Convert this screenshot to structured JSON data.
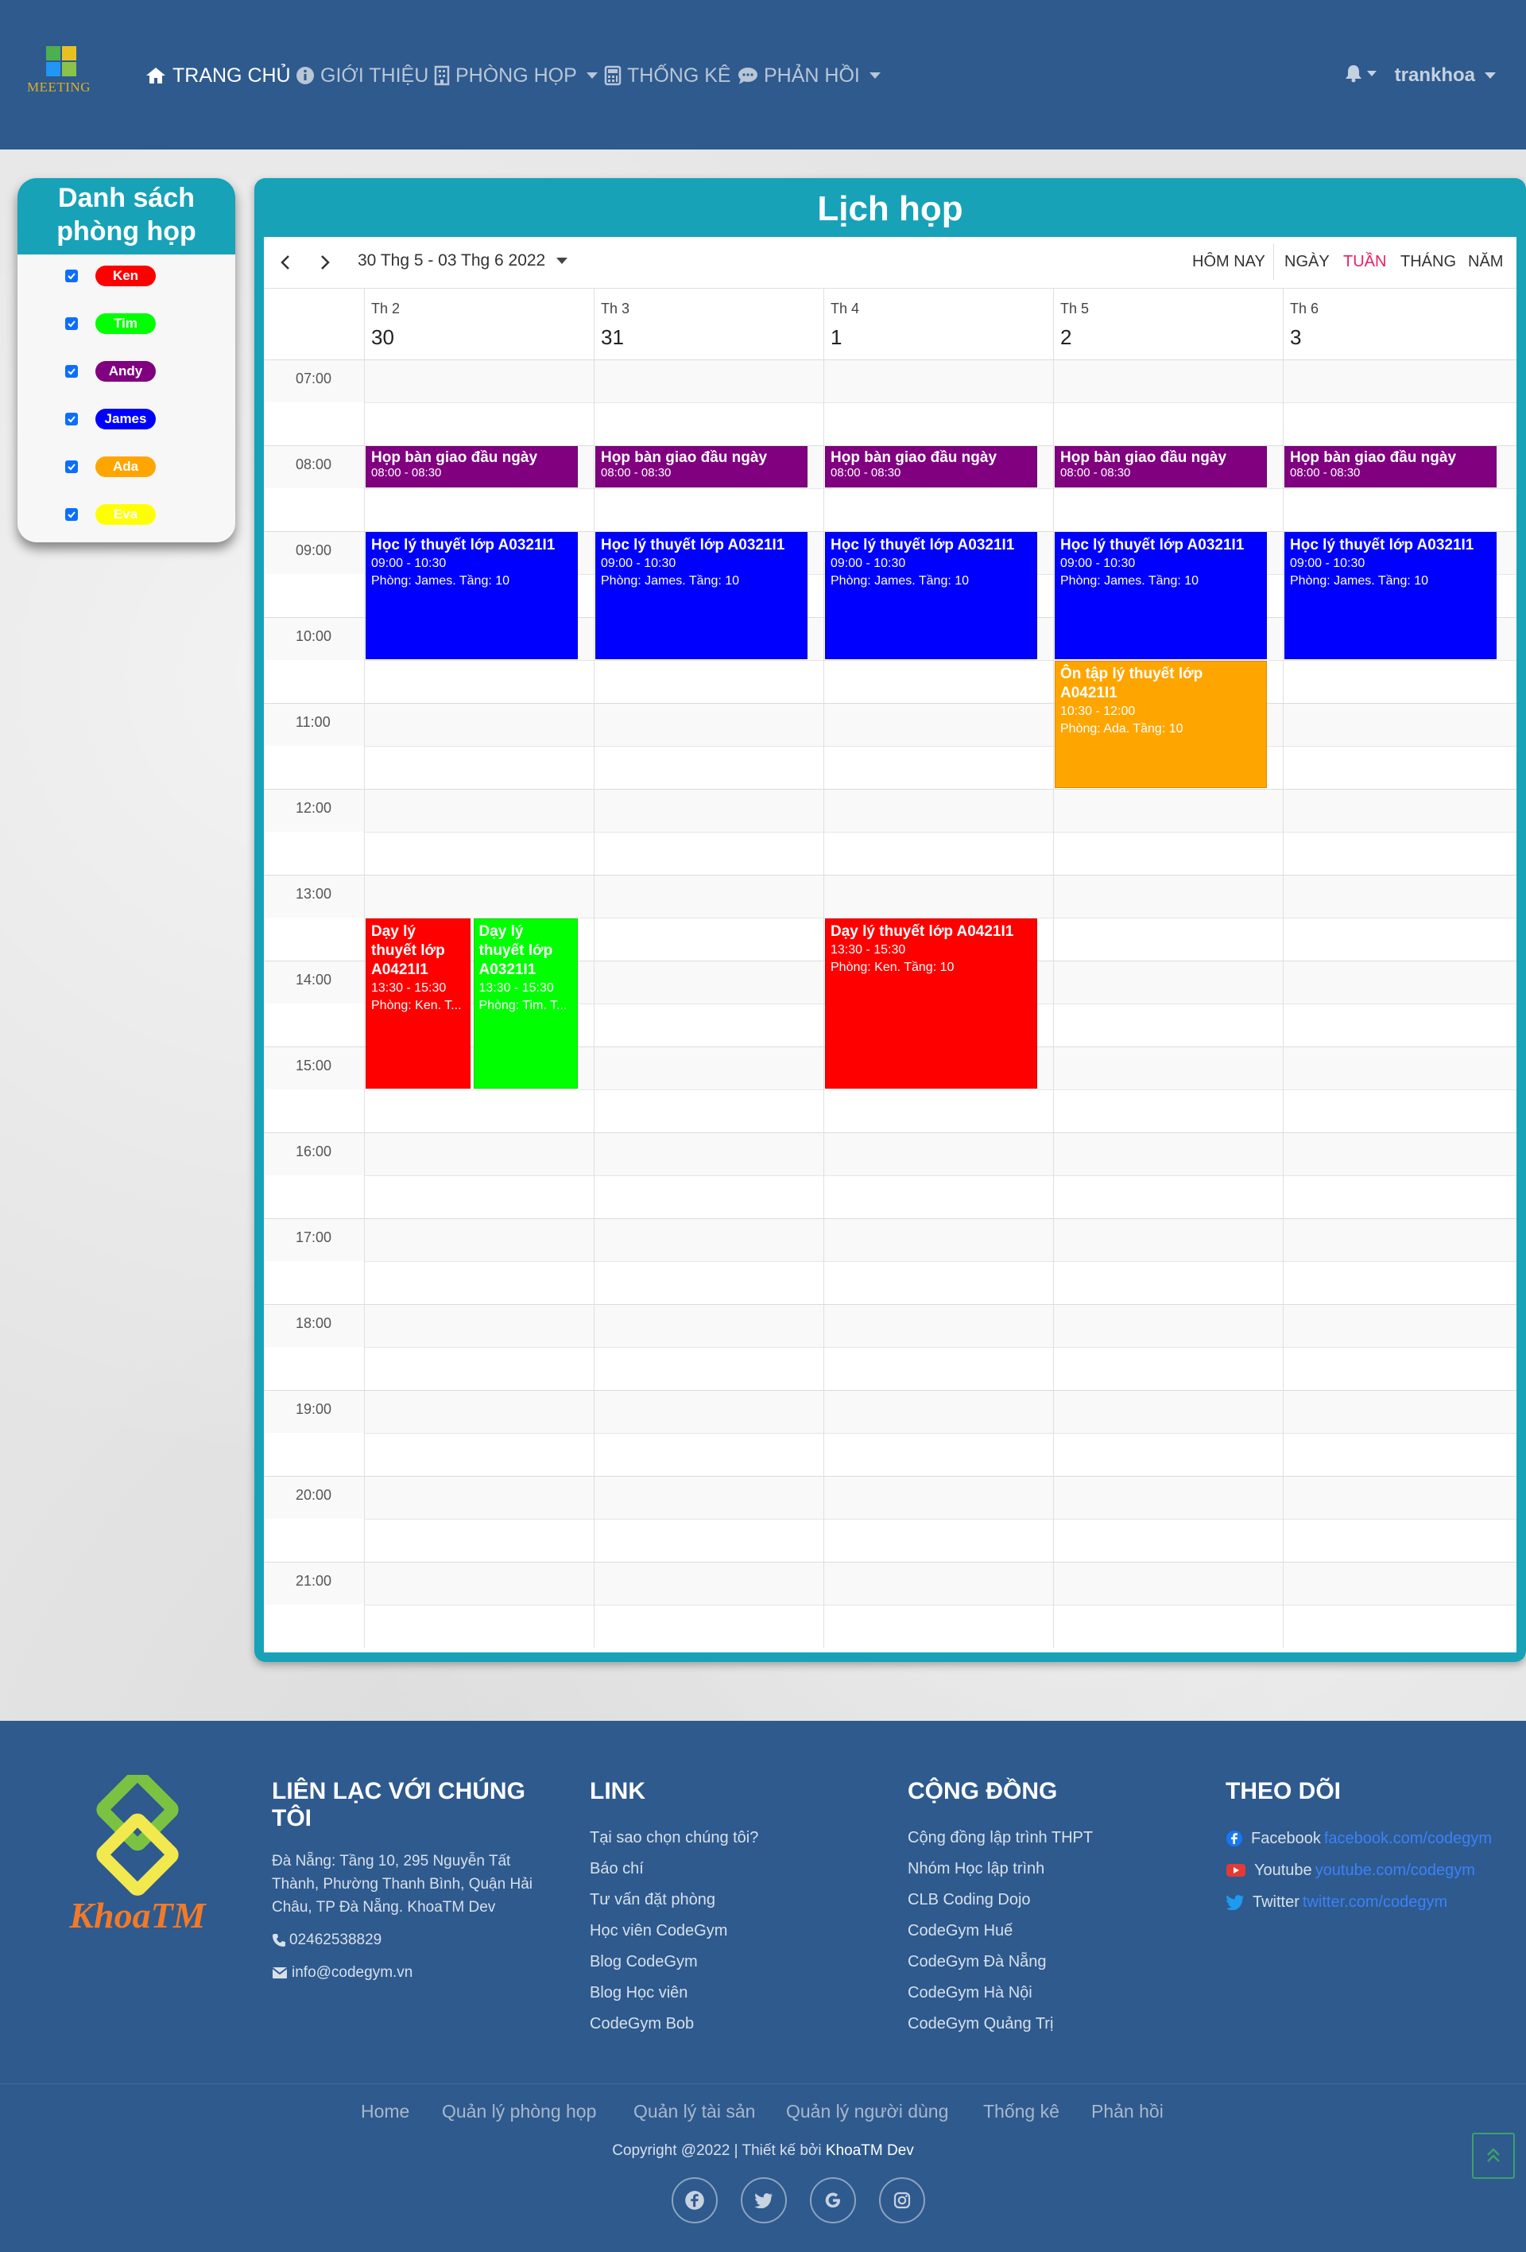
{
  "nav": {
    "logo_text": "MEETING",
    "items": [
      {
        "label": "TRANG CHỦ",
        "icon": "home-icon"
      },
      {
        "label": "GIỚI THIỆU",
        "icon": "info-icon"
      },
      {
        "label": "PHÒNG HỌP",
        "icon": "building-icon"
      },
      {
        "label": "THỐNG KÊ",
        "icon": "calculator-icon"
      },
      {
        "label": "PHẢN HỒI",
        "icon": "comment-icon"
      }
    ],
    "username": "trankhoa"
  },
  "rooms": {
    "title_line1": "Danh sách",
    "title_line2": "phòng họp",
    "items": [
      {
        "name": "Ken",
        "color": "#ff0000",
        "checked": true
      },
      {
        "name": "Tim",
        "color": "#00ff00",
        "checked": true
      },
      {
        "name": "Andy",
        "color": "#800080",
        "checked": true
      },
      {
        "name": "James",
        "color": "#0000ff",
        "checked": true
      },
      {
        "name": "Ada",
        "color": "#ffa500",
        "checked": true
      },
      {
        "name": "Eva",
        "color": "#ffff00",
        "checked": true
      }
    ]
  },
  "calendar": {
    "title": "Lịch họp",
    "range": "30 Thg 5 - 03 Thg 6 2022",
    "views": {
      "today": "HÔM NAY",
      "day": "NGÀY",
      "week": "TUẦN",
      "month": "THÁNG",
      "year": "NĂM"
    },
    "days": [
      {
        "name": "Th 2",
        "date": "30"
      },
      {
        "name": "Th 3",
        "date": "31"
      },
      {
        "name": "Th 4",
        "date": "1"
      },
      {
        "name": "Th 5",
        "date": "2"
      },
      {
        "name": "Th 6",
        "date": "3"
      }
    ],
    "hours": [
      "07:00",
      "08:00",
      "09:00",
      "10:00",
      "11:00",
      "12:00",
      "13:00",
      "14:00",
      "15:00",
      "16:00",
      "17:00",
      "18:00",
      "19:00",
      "20:00",
      "21:00"
    ],
    "events": [
      {
        "day": 0,
        "title": "Họp bàn giao đầu ngày",
        "time": "08:00 - 08:30",
        "room": "",
        "color": "purple"
      },
      {
        "day": 1,
        "title": "Họp bàn giao đầu ngày",
        "time": "08:00 - 08:30",
        "room": "",
        "color": "purple"
      },
      {
        "day": 2,
        "title": "Họp bàn giao đầu ngày",
        "time": "08:00 - 08:30",
        "room": "",
        "color": "purple"
      },
      {
        "day": 3,
        "title": "Họp bàn giao đầu ngày",
        "time": "08:00 - 08:30",
        "room": "",
        "color": "purple"
      },
      {
        "day": 4,
        "title": "Họp bàn giao đầu ngày",
        "time": "08:00 - 08:30",
        "room": "",
        "color": "purple"
      },
      {
        "day": 0,
        "title": "Học lý thuyết lớp A0321I1",
        "time": "09:00 - 10:30",
        "room": "Phòng: James. Tầng: 10",
        "color": "blue"
      },
      {
        "day": 1,
        "title": "Học lý thuyết lớp A0321I1",
        "time": "09:00 - 10:30",
        "room": "Phòng: James. Tầng: 10",
        "color": "blue"
      },
      {
        "day": 2,
        "title": "Học lý thuyết lớp A0321I1",
        "time": "09:00 - 10:30",
        "room": "Phòng: James. Tầng: 10",
        "color": "blue"
      },
      {
        "day": 3,
        "title": "Học lý thuyết lớp A0321I1",
        "time": "09:00 - 10:30",
        "room": "Phòng: James. Tầng: 10",
        "color": "blue"
      },
      {
        "day": 4,
        "title": "Học lý thuyết lớp A0321I1",
        "time": "09:00 - 10:30",
        "room": "Phòng: James. Tầng: 10",
        "color": "blue"
      },
      {
        "day": 3,
        "title": "Ôn tập lý thuyết lớp A0421I1",
        "time": "10:30 - 12:00",
        "room": "Phòng: Ada. Tầng: 10",
        "color": "orange"
      },
      {
        "day": 0,
        "title": "Dạy lý thuyết lớp A0421I1",
        "time": "13:30 - 15:30",
        "room": "Phòng: Ken. T...",
        "color": "red"
      },
      {
        "day": 0,
        "title": "Dạy lý thuyết lớp A0321I1",
        "time": "13:30 - 15:30",
        "room": "Phòng: Tim. T...",
        "color": "green"
      },
      {
        "day": 2,
        "title": "Dạy lý thuyết lớp A0421I1",
        "time": "13:30 - 15:30",
        "room": "Phòng: Ken. Tầng: 10",
        "color": "red"
      }
    ]
  },
  "footer": {
    "brand": "KhoaTM",
    "contact": {
      "title": "LIÊN LẠC VỚI CHÚNG TÔI",
      "address_1": "Đà Nẵng: Tầng 10, 295 Nguyễn Tất",
      "address_2": "Thành, Phường Thanh Bình, Quận Hải",
      "address_3": "Châu, TP Đà Nẵng. KhoaTM Dev",
      "phone": "02462538829",
      "email": "info@codegym.vn"
    },
    "link": {
      "title": "LINK",
      "items": [
        "Tại sao chọn chúng tôi?",
        "Báo chí",
        "Tư vấn đặt phòng",
        "Học viên CodeGym",
        "Blog CodeGym",
        "Blog Học viên",
        "CodeGym Bob"
      ]
    },
    "community": {
      "title": "CỘNG ĐỒNG",
      "items": [
        "Cộng đồng lập trình THPT",
        "Nhóm Học lập trình",
        "CLB Coding Dojo",
        "CodeGym Huế",
        "CodeGym Đà Nẵng",
        "CodeGym Hà Nội",
        "CodeGym Quảng Trị"
      ]
    },
    "follow": {
      "title": "THEO DÕI",
      "items": [
        {
          "name": "Facebook",
          "link": "facebook.com/codegym"
        },
        {
          "name": "Youtube",
          "link": "youtube.com/codegym"
        },
        {
          "name": "Twitter",
          "link": "twitter.com/codegym"
        }
      ]
    },
    "bottom_nav": [
      "Home",
      "Quản lý phòng họp",
      "Quản lý tài sản",
      "Quản lý người dùng",
      "Thống kê",
      "Phản hồi"
    ],
    "copyright": "Copyright @2022 | Thiết kế bởi",
    "copyright_author": "KhoaTM Dev"
  }
}
